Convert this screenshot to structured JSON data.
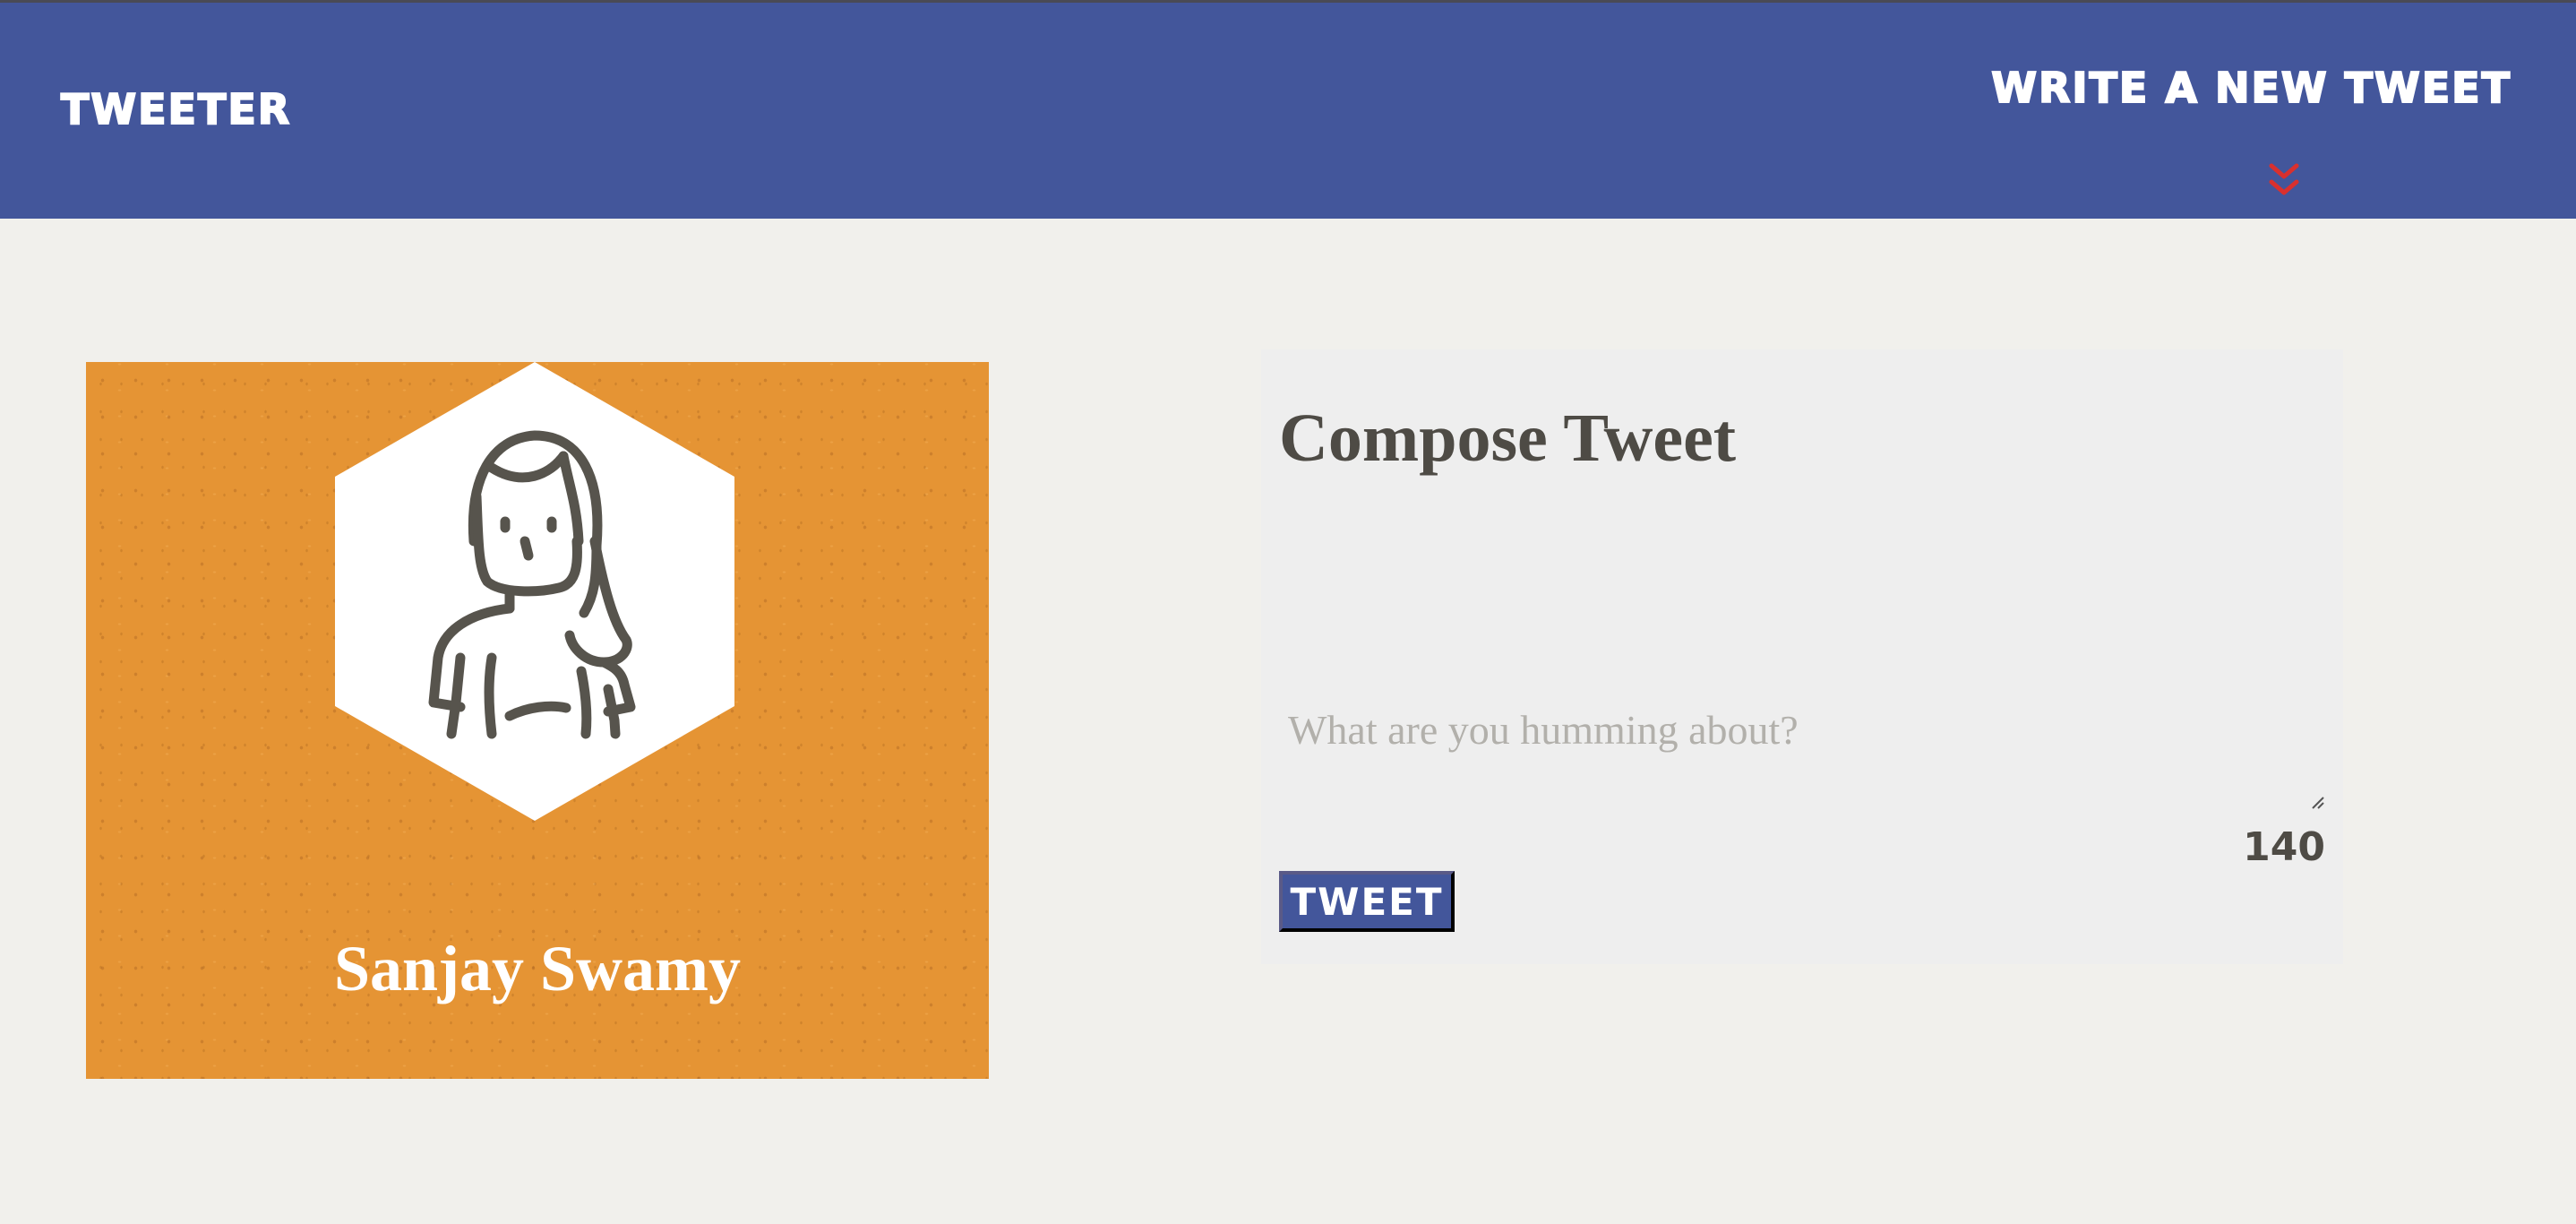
{
  "header": {
    "brand": "TWEETER",
    "write_new": "WRITE A NEW TWEET",
    "chevron_icon": "double-chevron-down-icon"
  },
  "profile": {
    "name": "Sanjay Swamy",
    "avatar_icon": "user-avatar-icon"
  },
  "compose": {
    "title": "Compose Tweet",
    "placeholder": "What are you humming about?",
    "value": "",
    "counter": "140",
    "button_label": "TWEET"
  },
  "colors": {
    "header_bg": "#43569b",
    "page_bg": "#f1f0ec",
    "profile_bg": "#e59434",
    "compose_bg": "#eeeeee",
    "accent_chevron": "#d9302e",
    "text_dark": "#4e4b45"
  }
}
